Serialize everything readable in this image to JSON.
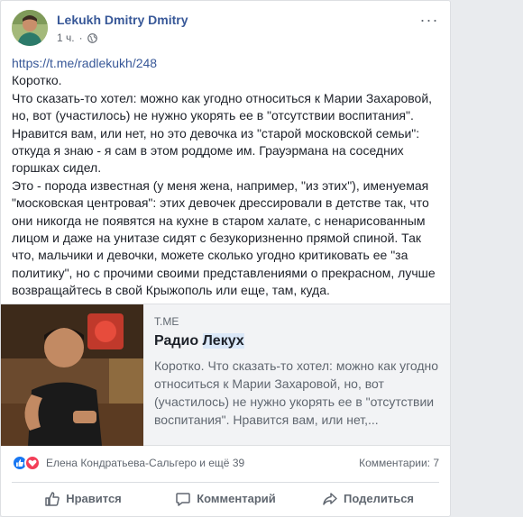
{
  "post": {
    "author": "Lekukh Dmitry Dmitry",
    "time": "1 ч.",
    "link": "https://t.me/radlekukh/248",
    "paragraphs": [
      "Коротко.",
      "Что сказать-то хотел: можно как угодно относиться к Марии Захаровой,\nно, вот (участилось) не нужно укорять ее в \"отсутствии воспитания\".\nНравится вам, или нет, но это девочка из \"старой московской семьи\":\nоткуда я знаю - я сам в этом роддоме им. Грауэрмана на соседних\nгоршках сидел.",
      "Это - порода известная (у меня жена, например, \"из этих\"), именуемая\n\"московская центровая\": этих девочек дрессировали в детстве так, что\nони никогда не появятся на кухне в старом халате, с ненарисованным\nлицом и даже на унитазе сидят с безукоризненно прямой спиной. Так\nчто, мальчики и девочки, можете сколько угодно критиковать ее \"за\nполитику\", но с прочими своими представлениями о прекрасном, лучше\nвозвращайтесь в свой Крыжополь или еще, там, куда."
    ]
  },
  "preview": {
    "domain": "T.ME",
    "title_prefix": "Радио ",
    "title_highlight": "Лекух",
    "description": "Коротко. Что сказать-то хотел: можно как угодно относиться к Марии Захаровой, но, вот (участилось) не нужно укорять ее в \"отсутствии воспитания\". Нравится вам, или нет,..."
  },
  "reactions": {
    "names": "Елена Кондратьева-Сальгеро и ещё 39",
    "comments": "Комментарии: 7",
    "icons": [
      "like-icon",
      "love-icon"
    ],
    "colors": {
      "like": "#1877f2",
      "love": "#f33e58"
    }
  },
  "actions": {
    "like": "Нравится",
    "comment": "Комментарий",
    "share": "Поделиться"
  },
  "colors": {
    "link": "#385898",
    "muted": "#606770"
  }
}
